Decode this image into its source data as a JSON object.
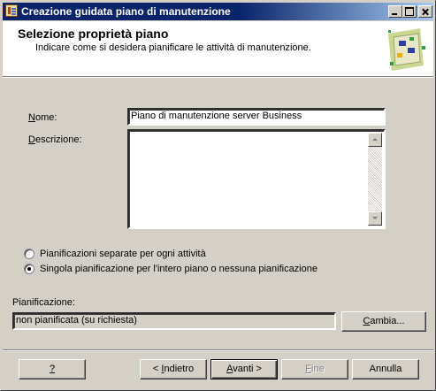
{
  "window": {
    "title": "Creazione guidata piano di manutenzione"
  },
  "header": {
    "title": "Selezione proprietà piano",
    "subtitle": "Indicare come si desidera pianificare le attività di manutenzione."
  },
  "form": {
    "name_label": "Nome:",
    "name_value": "Piano di manutenzione server Business",
    "description_label": "Descrizione:",
    "description_value": ""
  },
  "schedule_options": [
    {
      "label": "Pianificazioni separate per ogni attività",
      "selected": false
    },
    {
      "label": "Singola pianificazione per l'intero piano o nessuna pianificazione",
      "selected": true
    }
  ],
  "schedule": {
    "label": "Pianificazione:",
    "value": "non pianificata (su richiesta)",
    "change_button": "Cambia..."
  },
  "buttons": {
    "help": "?",
    "back": "< Indietro",
    "next": "Avanti >",
    "finish": "Fine",
    "cancel": "Annulla"
  }
}
